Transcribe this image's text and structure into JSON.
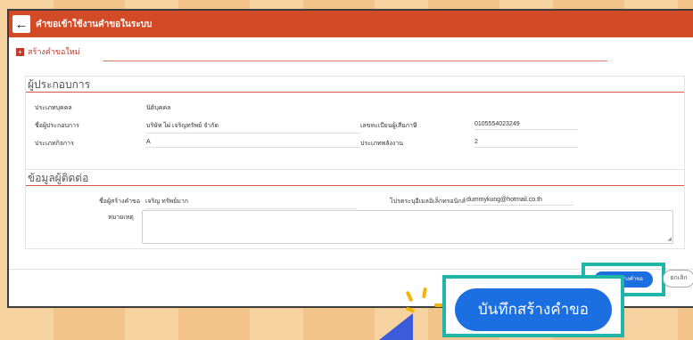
{
  "window": {
    "title": "คำขอเข้าใช้งานคำขอในระบบ"
  },
  "subheader": {
    "label": "สร้างคำขอใหม่"
  },
  "operator_section": {
    "title": "ผู้ประกอบการ",
    "fields": [
      {
        "label": "ประเภทบุคคล",
        "value": "นิติบุคคล"
      },
      {
        "label": "ชื่อผู้ประกอบการ",
        "value": "บริษัท ไผ่ เจริญทรัพย์ จำกัด"
      },
      {
        "label": "เลขทะเบียนผู้เสียภาษี",
        "value": "0105554023249"
      },
      {
        "label": "ประเภทกิจการ",
        "value": "A"
      },
      {
        "label": "ประเภทพลังงาน",
        "value": "2"
      }
    ]
  },
  "contact_section": {
    "title": "ข้อมูลผู้ติดต่อ",
    "requester_label": "ชื่อผู้สร้างคำขอ",
    "requester_value": "เจริญ ทรัพย์มาก",
    "email_label": "โปรดระบุอีเมลอิเล็กทรอนิกส์",
    "email_value": "dummykung@hotmail.co.th",
    "note_label": "หมายเหตุ",
    "note_value": ""
  },
  "actions": {
    "save_label": "บันทึกสร้างคำขอ",
    "cancel_label": "ยกเลิก"
  },
  "callout": {
    "save_label": "บันทึกสร้างคำขอ"
  },
  "colors": {
    "header": "#d24a26",
    "primary": "#1c6fe0",
    "highlight": "#1fb5a8",
    "accent_red": "#c0392b"
  }
}
